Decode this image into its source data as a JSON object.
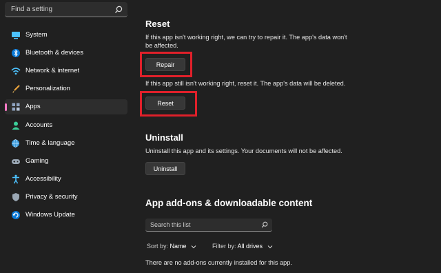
{
  "sidebar": {
    "search_placeholder": "Find a setting",
    "items": [
      {
        "label": "System",
        "icon": "monitor-icon"
      },
      {
        "label": "Bluetooth & devices",
        "icon": "bluetooth-icon"
      },
      {
        "label": "Network & internet",
        "icon": "wifi-icon"
      },
      {
        "label": "Personalization",
        "icon": "brush-icon"
      },
      {
        "label": "Apps",
        "icon": "apps-icon",
        "selected": true
      },
      {
        "label": "Accounts",
        "icon": "person-icon"
      },
      {
        "label": "Time & language",
        "icon": "globe-clock-icon"
      },
      {
        "label": "Gaming",
        "icon": "gamepad-icon"
      },
      {
        "label": "Accessibility",
        "icon": "accessibility-icon"
      },
      {
        "label": "Privacy & security",
        "icon": "shield-icon"
      },
      {
        "label": "Windows Update",
        "icon": "update-icon"
      }
    ]
  },
  "reset": {
    "title": "Reset",
    "repair_desc": "If this app isn't working right, we can try to repair it. The app's data won't be affected.",
    "repair_label": "Repair",
    "reset_desc": "If this app still isn't working right, reset it. The app's data will be deleted.",
    "reset_label": "Reset"
  },
  "uninstall": {
    "title": "Uninstall",
    "desc": "Uninstall this app and its settings. Your documents will not be affected.",
    "button_label": "Uninstall"
  },
  "addons": {
    "title": "App add-ons & downloadable content",
    "search_placeholder": "Search this list",
    "sort_label": "Sort by:",
    "sort_value": "Name",
    "filter_label": "Filter by:",
    "filter_value": "All drives",
    "empty_message": "There are no add-ons currently installed for this app."
  },
  "colors": {
    "background": "#202020",
    "highlight_box": "#e0202a",
    "selected_pill": "#ff7ac6"
  }
}
